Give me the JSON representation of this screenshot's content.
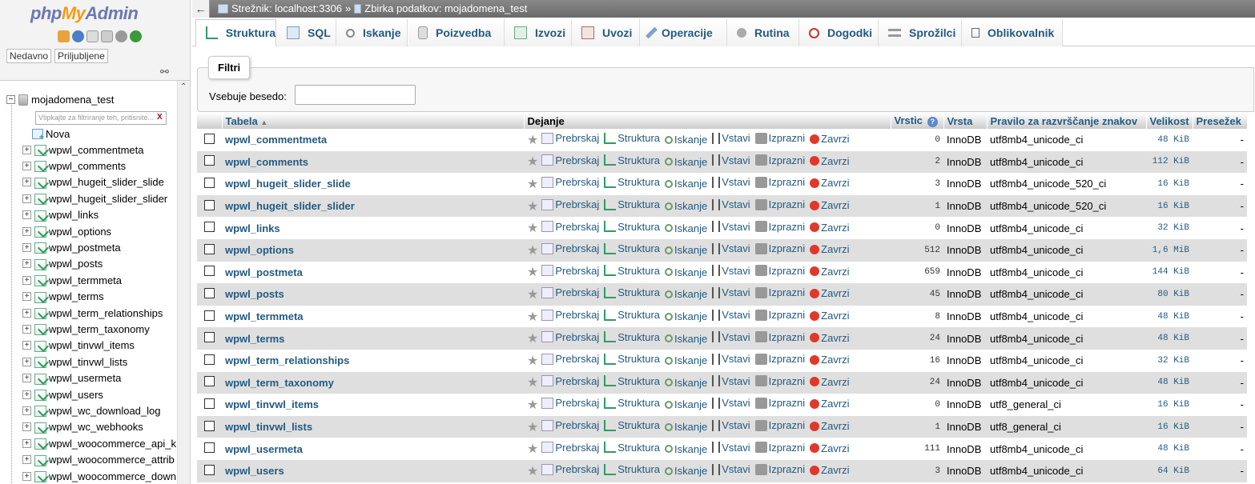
{
  "app": {
    "logo_php": "php",
    "logo_my": "My",
    "logo_admin": "Admin"
  },
  "nav": {
    "tabs": [
      "Nedavno",
      "Priljubljene"
    ],
    "database": "mojadomena_test",
    "filter_placeholder": "Vtipkajte za filtriranje teh, pritisnite...",
    "filter_clear": "X",
    "new_label": "Nova",
    "tables": [
      "wpwl_commentmeta",
      "wpwl_comments",
      "wpwl_hugeit_slider_slide",
      "wpwl_hugeit_slider_slider",
      "wpwl_links",
      "wpwl_options",
      "wpwl_postmeta",
      "wpwl_posts",
      "wpwl_termmeta",
      "wpwl_terms",
      "wpwl_term_relationships",
      "wpwl_term_taxonomy",
      "wpwl_tinvwl_items",
      "wpwl_tinvwl_lists",
      "wpwl_usermeta",
      "wpwl_users",
      "wpwl_wc_download_log",
      "wpwl_wc_webhooks",
      "wpwl_woocommerce_api_k",
      "wpwl_woocommerce_attrib",
      "wpwl_woocommerce_down"
    ]
  },
  "breadcrumb": {
    "server": "Strežnik: localhost:3306",
    "separator": "»",
    "database": "Zbirka podatkov: mojadomena_test"
  },
  "menu": [
    "Struktura",
    "SQL",
    "Iskanje",
    "Poizvedba",
    "Izvozi",
    "Uvozi",
    "Operacije",
    "Rutina",
    "Dogodki",
    "Sprožilci",
    "Oblikovalnik"
  ],
  "filter": {
    "legend": "Filtri",
    "label": "Vsebuje besedo:",
    "value": ""
  },
  "table": {
    "headers": {
      "name": "Tabela",
      "action": "Dejanje",
      "rows": "Vrstic",
      "type": "Vrsta",
      "collation": "Pravilo za razvrščanje znakov",
      "size": "Velikost",
      "overhead": "Presežek"
    },
    "actions": [
      "Prebrskaj",
      "Struktura",
      "Iskanje",
      "Vstavi",
      "Izprazni",
      "Zavrzi"
    ],
    "rows": [
      {
        "name": "wpwl_commentmeta",
        "rows": "0",
        "type": "InnoDB",
        "collation": "utf8mb4_unicode_ci",
        "size": "48 KiB",
        "overhead": "-"
      },
      {
        "name": "wpwl_comments",
        "rows": "2",
        "type": "InnoDB",
        "collation": "utf8mb4_unicode_ci",
        "size": "112 KiB",
        "overhead": "-"
      },
      {
        "name": "wpwl_hugeit_slider_slide",
        "rows": "3",
        "type": "InnoDB",
        "collation": "utf8mb4_unicode_520_ci",
        "size": "16 KiB",
        "overhead": "-"
      },
      {
        "name": "wpwl_hugeit_slider_slider",
        "rows": "1",
        "type": "InnoDB",
        "collation": "utf8mb4_unicode_520_ci",
        "size": "16 KiB",
        "overhead": "-"
      },
      {
        "name": "wpwl_links",
        "rows": "0",
        "type": "InnoDB",
        "collation": "utf8mb4_unicode_ci",
        "size": "32 KiB",
        "overhead": "-"
      },
      {
        "name": "wpwl_options",
        "rows": "512",
        "type": "InnoDB",
        "collation": "utf8mb4_unicode_ci",
        "size": "1,6 MiB",
        "overhead": "-"
      },
      {
        "name": "wpwl_postmeta",
        "rows": "659",
        "type": "InnoDB",
        "collation": "utf8mb4_unicode_ci",
        "size": "144 KiB",
        "overhead": "-"
      },
      {
        "name": "wpwl_posts",
        "rows": "45",
        "type": "InnoDB",
        "collation": "utf8mb4_unicode_ci",
        "size": "80 KiB",
        "overhead": "-"
      },
      {
        "name": "wpwl_termmeta",
        "rows": "8",
        "type": "InnoDB",
        "collation": "utf8mb4_unicode_ci",
        "size": "48 KiB",
        "overhead": "-"
      },
      {
        "name": "wpwl_terms",
        "rows": "24",
        "type": "InnoDB",
        "collation": "utf8mb4_unicode_ci",
        "size": "48 KiB",
        "overhead": "-"
      },
      {
        "name": "wpwl_term_relationships",
        "rows": "16",
        "type": "InnoDB",
        "collation": "utf8mb4_unicode_ci",
        "size": "32 KiB",
        "overhead": "-"
      },
      {
        "name": "wpwl_term_taxonomy",
        "rows": "24",
        "type": "InnoDB",
        "collation": "utf8mb4_unicode_ci",
        "size": "48 KiB",
        "overhead": "-"
      },
      {
        "name": "wpwl_tinvwl_items",
        "rows": "0",
        "type": "InnoDB",
        "collation": "utf8_general_ci",
        "size": "16 KiB",
        "overhead": "-"
      },
      {
        "name": "wpwl_tinvwl_lists",
        "rows": "1",
        "type": "InnoDB",
        "collation": "utf8_general_ci",
        "size": "16 KiB",
        "overhead": "-"
      },
      {
        "name": "wpwl_usermeta",
        "rows": "111",
        "type": "InnoDB",
        "collation": "utf8mb4_unicode_ci",
        "size": "48 KiB",
        "overhead": "-"
      },
      {
        "name": "wpwl_users",
        "rows": "3",
        "type": "InnoDB",
        "collation": "utf8mb4_unicode_ci",
        "size": "64 KiB",
        "overhead": "-"
      }
    ]
  },
  "colors": {
    "link": "#235a81",
    "logo_blue": "#6c78af",
    "logo_orange": "#f89c0e",
    "stop": "#e0382b"
  }
}
